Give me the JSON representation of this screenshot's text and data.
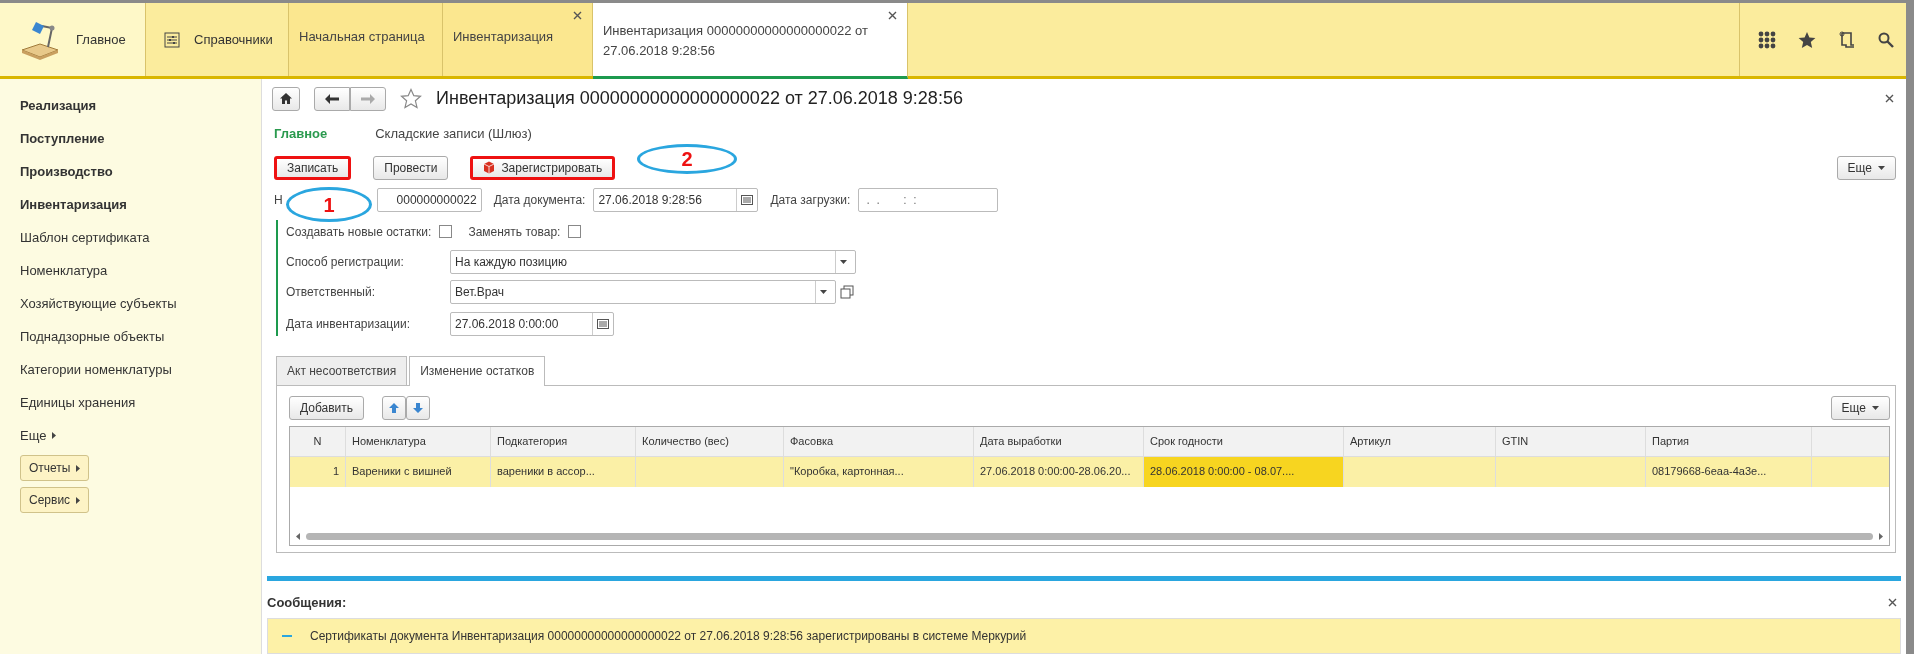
{
  "top_bar": {
    "sections": [
      {
        "label": "Главное"
      },
      {
        "label": "Справочники"
      }
    ],
    "tabs": [
      {
        "label": "Начальная страница",
        "closable": false,
        "selected": false
      },
      {
        "label": "Инвентаризация",
        "closable": true,
        "selected": false
      },
      {
        "label": "Инвентаризация 00000000000000000022 от 27.06.2018 9:28:56",
        "closable": true,
        "selected": true
      }
    ]
  },
  "sidebar": {
    "items": [
      {
        "label": "Реализация",
        "kind": "section"
      },
      {
        "label": "Поступление",
        "kind": "section"
      },
      {
        "label": "Производство",
        "kind": "section"
      },
      {
        "label": "Инвентаризация",
        "kind": "section"
      },
      {
        "label": "Шаблон сертификата",
        "kind": "link"
      },
      {
        "label": "Номенклатура",
        "kind": "link"
      },
      {
        "label": "Хозяйствующие субъекты",
        "kind": "link"
      },
      {
        "label": "Поднадзорные объекты",
        "kind": "link"
      },
      {
        "label": "Категории номенклатуры",
        "kind": "link"
      },
      {
        "label": "Единицы хранения",
        "kind": "link"
      },
      {
        "label": "Еще",
        "kind": "more"
      }
    ],
    "buttons": [
      "Отчеты",
      "Сервис"
    ]
  },
  "form": {
    "title": "Инвентаризация 00000000000000000022 от 27.06.2018 9:28:56",
    "nav": [
      {
        "label": "Главное",
        "selected": true
      },
      {
        "label": "Складские записи (Шлюз)",
        "selected": false
      }
    ],
    "toolbar": [
      {
        "label": "Записать",
        "highlighted": true,
        "kind": "plain"
      },
      {
        "label": "Провести",
        "highlighted": false,
        "kind": "plain"
      },
      {
        "label": "Зарегистрировать",
        "highlighted": true,
        "kind": "icon"
      }
    ],
    "more": "Еще",
    "number": {
      "label": "Н",
      "value": "000000000022"
    },
    "doc_date": {
      "label": "Дата документа:",
      "value": "27.06.2018  9:28:56"
    },
    "load_date": {
      "label": "Дата загрузки:",
      "placeholder": " .  .       :  :"
    },
    "checkboxes": [
      {
        "label": "Создавать новые остатки:",
        "checked": false
      },
      {
        "label": "Заменять товар:",
        "checked": false
      }
    ],
    "fields": [
      {
        "label": "Способ регистрации:",
        "value": "На каждую позицию",
        "kind": "select"
      },
      {
        "label": "Ответственный:",
        "value": "Вет.Врач",
        "kind": "reference"
      },
      {
        "label": "Дата инвентаризации:",
        "value": "27.06.2018  0:00:00",
        "kind": "date"
      }
    ],
    "tabs": [
      {
        "label": "Акт несоответствия",
        "selected": false
      },
      {
        "label": "Изменение остатков",
        "selected": true
      }
    ],
    "table": {
      "add": "Добавить",
      "more": "Еще",
      "columns": [
        "N",
        "Номенклатура",
        "Подкатегория",
        "Количество (вес)",
        "Фасовка",
        "Дата выработки",
        "Срок годности",
        "Артикул",
        "GTIN",
        "Партия"
      ],
      "rows": [
        {
          "selected": true,
          "cells": [
            {
              "text": "1",
              "current": false
            },
            {
              "text": "Вареники с вишней",
              "current": false
            },
            {
              "text": "вареники в ассор...",
              "current": false
            },
            {
              "current": false
            },
            {
              "text": "\"Коробка, картонная...",
              "current": false
            },
            {
              "text": "27.06.2018 0:00:00-28.06.20...",
              "current": false
            },
            {
              "text": "28.06.2018 0:00:00 - 08.07....",
              "current": true
            },
            {
              "current": false
            },
            {
              "current": false
            },
            {
              "text": "08179668-6eaa-4a3e...",
              "current": false
            }
          ]
        }
      ]
    }
  },
  "messages": {
    "title": "Сообщения:",
    "items": [
      {
        "text": "Сертификаты документа Инвентаризация 00000000000000000022 от 27.06.2018 9:28:56 зарегистрированы в системе Меркурий"
      }
    ]
  },
  "annotations": [
    {
      "label": "1"
    },
    {
      "label": "2"
    }
  ]
}
